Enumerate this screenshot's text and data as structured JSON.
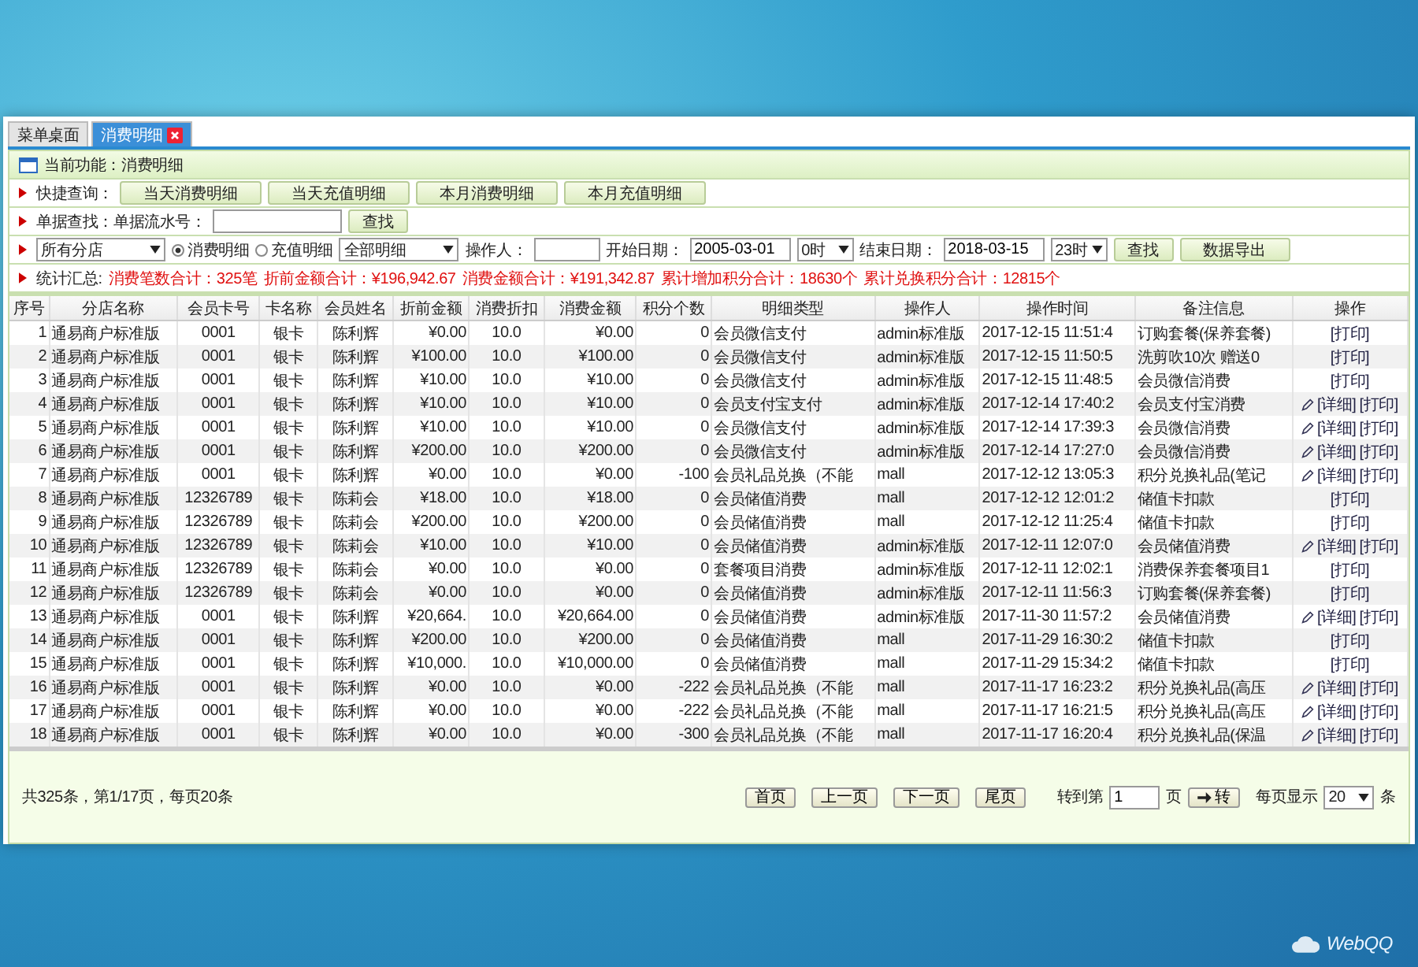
{
  "tabs": [
    {
      "label": "菜单桌面",
      "selected": false,
      "closable": false
    },
    {
      "label": "消费明细",
      "selected": true,
      "closable": true
    }
  ],
  "current_function": "当前功能：消费明细",
  "quick_query": {
    "label": "快捷查询：",
    "buttons": [
      "当天消费明细",
      "当天充值明细",
      "本月消费明细",
      "本月充值明细"
    ]
  },
  "receipt_search": {
    "label": "单据查找：单据流水号：",
    "button": "查找"
  },
  "filter": {
    "store": "所有分店",
    "radios": [
      {
        "label": "消费明细",
        "selected": true
      },
      {
        "label": "充值明细",
        "selected": false
      }
    ],
    "detail_type": "全部明细",
    "operator_label": "操作人：",
    "start_label": "开始日期：",
    "start_date": "2005-03-01",
    "start_hour": "0时",
    "end_label": "结束日期：",
    "end_date": "2018-03-15",
    "end_hour": "23时",
    "search_button": "查找",
    "export_button": "数据导出"
  },
  "stats": {
    "label": "统计汇总:",
    "items": [
      "消费笔数合计：325笔",
      "折前金额合计：¥196,942.67",
      "消费金额合计：¥191,342.87",
      "累计增加积分合计：18630个",
      "累计兑换积分合计：12815个"
    ]
  },
  "table": {
    "columns": [
      "序号",
      "分店名称",
      "会员卡号",
      "卡名称",
      "会员姓名",
      "折前金额",
      "消费折扣",
      "消费金额",
      "积分个数",
      "明细类型",
      "操作人",
      "操作时间",
      "备注信息",
      "操作"
    ],
    "rows": [
      {
        "cells": [
          "1",
          "通易商户标准版",
          "0001",
          "银卡",
          "陈利辉",
          "¥0.00",
          "10.0",
          "¥0.00",
          "0",
          "会员微信支付",
          "admin标准版",
          "2017-12-15 11:51:4",
          "订购套餐(保养套餐)"
        ],
        "editable": false,
        "actions": [
          "[打印]"
        ]
      },
      {
        "cells": [
          "2",
          "通易商户标准版",
          "0001",
          "银卡",
          "陈利辉",
          "¥100.00",
          "10.0",
          "¥100.00",
          "0",
          "会员微信支付",
          "admin标准版",
          "2017-12-15 11:50:5",
          "洗剪吹10次 赠送0"
        ],
        "editable": false,
        "actions": [
          "[打印]"
        ]
      },
      {
        "cells": [
          "3",
          "通易商户标准版",
          "0001",
          "银卡",
          "陈利辉",
          "¥10.00",
          "10.0",
          "¥10.00",
          "0",
          "会员微信支付",
          "admin标准版",
          "2017-12-15 11:48:5",
          "会员微信消费"
        ],
        "editable": false,
        "actions": [
          "[打印]"
        ]
      },
      {
        "cells": [
          "4",
          "通易商户标准版",
          "0001",
          "银卡",
          "陈利辉",
          "¥10.00",
          "10.0",
          "¥10.00",
          "0",
          "会员支付宝支付",
          "admin标准版",
          "2017-12-14 17:40:2",
          "会员支付宝消费"
        ],
        "editable": true,
        "actions": [
          "[详细]",
          "[打印]"
        ]
      },
      {
        "cells": [
          "5",
          "通易商户标准版",
          "0001",
          "银卡",
          "陈利辉",
          "¥10.00",
          "10.0",
          "¥10.00",
          "0",
          "会员微信支付",
          "admin标准版",
          "2017-12-14 17:39:3",
          "会员微信消费"
        ],
        "editable": true,
        "actions": [
          "[详细]",
          "[打印]"
        ]
      },
      {
        "cells": [
          "6",
          "通易商户标准版",
          "0001",
          "银卡",
          "陈利辉",
          "¥200.00",
          "10.0",
          "¥200.00",
          "0",
          "会员微信支付",
          "admin标准版",
          "2017-12-14 17:27:0",
          "会员微信消费"
        ],
        "editable": true,
        "actions": [
          "[详细]",
          "[打印]"
        ]
      },
      {
        "cells": [
          "7",
          "通易商户标准版",
          "0001",
          "银卡",
          "陈利辉",
          "¥0.00",
          "10.0",
          "¥0.00",
          "-100",
          "会员礼品兑换（不能",
          "mall",
          "2017-12-12 13:05:3",
          "积分兑换礼品(笔记"
        ],
        "editable": true,
        "actions": [
          "[详细]",
          "[打印]"
        ]
      },
      {
        "cells": [
          "8",
          "通易商户标准版",
          "12326789",
          "银卡",
          "陈莉会",
          "¥18.00",
          "10.0",
          "¥18.00",
          "0",
          "会员储值消费",
          "mall",
          "2017-12-12 12:01:2",
          "储值卡扣款"
        ],
        "editable": false,
        "actions": [
          "[打印]"
        ]
      },
      {
        "cells": [
          "9",
          "通易商户标准版",
          "12326789",
          "银卡",
          "陈莉会",
          "¥200.00",
          "10.0",
          "¥200.00",
          "0",
          "会员储值消费",
          "mall",
          "2017-12-12 11:25:4",
          "储值卡扣款"
        ],
        "editable": false,
        "actions": [
          "[打印]"
        ]
      },
      {
        "cells": [
          "10",
          "通易商户标准版",
          "12326789",
          "银卡",
          "陈莉会",
          "¥10.00",
          "10.0",
          "¥10.00",
          "0",
          "会员储值消费",
          "admin标准版",
          "2017-12-11 12:07:0",
          "会员储值消费"
        ],
        "editable": true,
        "actions": [
          "[详细]",
          "[打印]"
        ]
      },
      {
        "cells": [
          "11",
          "通易商户标准版",
          "12326789",
          "银卡",
          "陈莉会",
          "¥0.00",
          "10.0",
          "¥0.00",
          "0",
          "套餐项目消费",
          "admin标准版",
          "2017-12-11 12:02:1",
          "消费保养套餐项目1"
        ],
        "editable": false,
        "actions": [
          "[打印]"
        ]
      },
      {
        "cells": [
          "12",
          "通易商户标准版",
          "12326789",
          "银卡",
          "陈莉会",
          "¥0.00",
          "10.0",
          "¥0.00",
          "0",
          "会员储值消费",
          "admin标准版",
          "2017-12-11 11:56:3",
          "订购套餐(保养套餐)"
        ],
        "editable": false,
        "actions": [
          "[打印]"
        ]
      },
      {
        "cells": [
          "13",
          "通易商户标准版",
          "0001",
          "银卡",
          "陈利辉",
          "¥20,664.",
          "10.0",
          "¥20,664.00",
          "0",
          "会员储值消费",
          "admin标准版",
          "2017-11-30 11:57:2",
          "会员储值消费"
        ],
        "editable": true,
        "actions": [
          "[详细]",
          "[打印]"
        ]
      },
      {
        "cells": [
          "14",
          "通易商户标准版",
          "0001",
          "银卡",
          "陈利辉",
          "¥200.00",
          "10.0",
          "¥200.00",
          "0",
          "会员储值消费",
          "mall",
          "2017-11-29 16:30:2",
          "储值卡扣款"
        ],
        "editable": false,
        "actions": [
          "[打印]"
        ]
      },
      {
        "cells": [
          "15",
          "通易商户标准版",
          "0001",
          "银卡",
          "陈利辉",
          "¥10,000.",
          "10.0",
          "¥10,000.00",
          "0",
          "会员储值消费",
          "mall",
          "2017-11-29 15:34:2",
          "储值卡扣款"
        ],
        "editable": false,
        "actions": [
          "[打印]"
        ]
      },
      {
        "cells": [
          "16",
          "通易商户标准版",
          "0001",
          "银卡",
          "陈利辉",
          "¥0.00",
          "10.0",
          "¥0.00",
          "-222",
          "会员礼品兑换（不能",
          "mall",
          "2017-11-17 16:23:2",
          "积分兑换礼品(高压"
        ],
        "editable": true,
        "actions": [
          "[详细]",
          "[打印]"
        ]
      },
      {
        "cells": [
          "17",
          "通易商户标准版",
          "0001",
          "银卡",
          "陈利辉",
          "¥0.00",
          "10.0",
          "¥0.00",
          "-222",
          "会员礼品兑换（不能",
          "mall",
          "2017-11-17 16:21:5",
          "积分兑换礼品(高压"
        ],
        "editable": true,
        "actions": [
          "[详细]",
          "[打印]"
        ]
      },
      {
        "cells": [
          "18",
          "通易商户标准版",
          "0001",
          "银卡",
          "陈利辉",
          "¥0.00",
          "10.0",
          "¥0.00",
          "-300",
          "会员礼品兑换（不能",
          "mall",
          "2017-11-17 16:20:4",
          "积分兑换礼品(保温"
        ],
        "editable": true,
        "actions": [
          "[详细]",
          "[打印]"
        ]
      }
    ]
  },
  "pagination": {
    "summary": "共325条，第1/17页，每页20条",
    "buttons": [
      "首页",
      "上一页",
      "下一页",
      "尾页"
    ],
    "goto_label": "转到第",
    "goto_value": "1",
    "page_unit": "页",
    "go_button": "转",
    "page_size_label": "每页显示",
    "page_size": "20",
    "page_size_unit": "条"
  },
  "brand": "WebQQ"
}
